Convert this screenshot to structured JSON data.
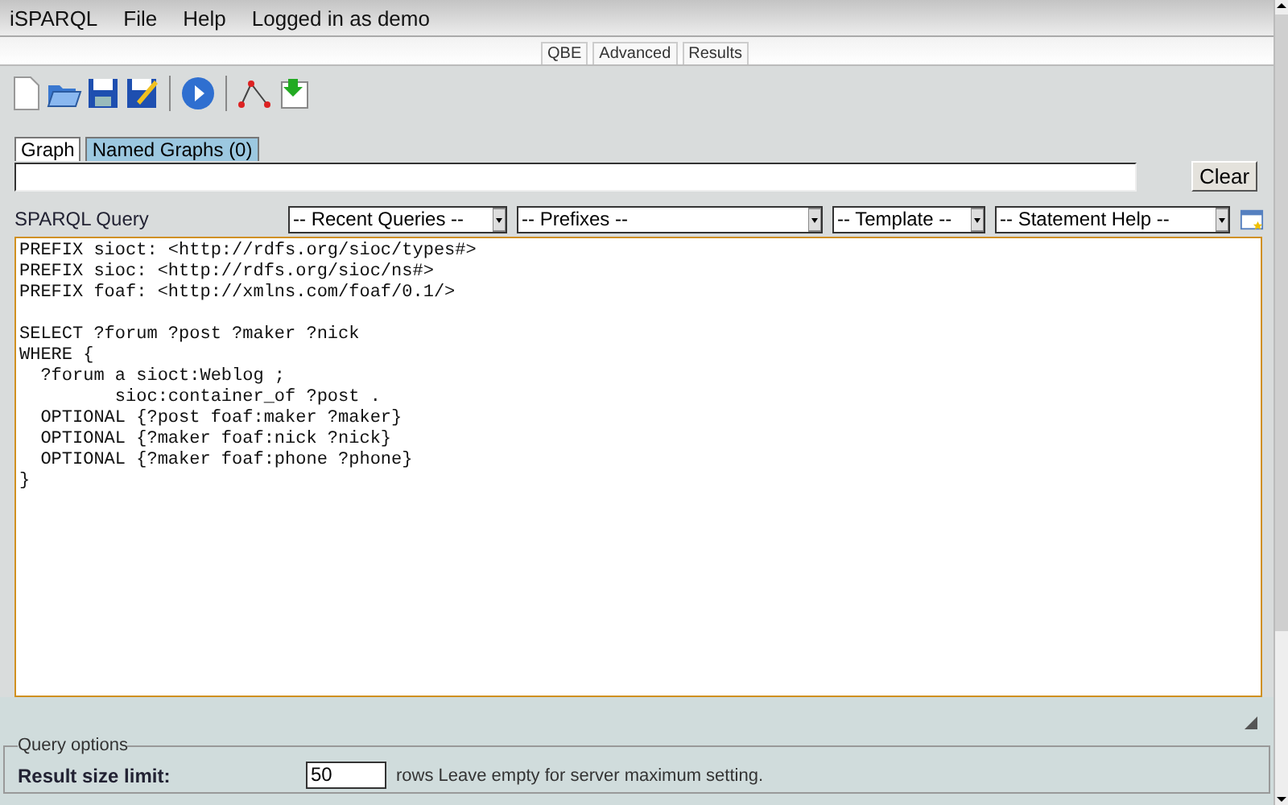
{
  "menu": [
    "iSPARQL",
    "File",
    "Help",
    "Logged in as demo"
  ],
  "view_tabs": [
    {
      "label": "QBE"
    },
    {
      "label": "Advanced"
    },
    {
      "label": "Results"
    }
  ],
  "graph_tabs": [
    {
      "label": "Graph",
      "selected": true
    },
    {
      "label": "Named Graphs (0)",
      "selected": false
    }
  ],
  "graph_input": {
    "button": "Clear"
  },
  "query": {
    "label": "SPARQL Query",
    "dropdowns": [
      "-- Recent Queries --",
      "-- Prefixes --",
      "-- Template --",
      "-- Statement Help --"
    ],
    "text": "PREFIX sioct: <http://rdfs.org/sioc/types#>\nPREFIX sioc: <http://rdfs.org/sioc/ns#>\nPREFIX foaf: <http://xmlns.com/foaf/0.1/>\n\nSELECT ?forum ?post ?maker ?nick\nWHERE {\n  ?forum a sioct:Weblog ;\n         sioc:container_of ?post .\n  OPTIONAL {?post foaf:maker ?maker}\n  OPTIONAL {?maker foaf:nick ?nick}\n  OPTIONAL {?maker foaf:phone ?phone}\n}"
  },
  "options": {
    "legend": "Query options",
    "label": "Result size limit:",
    "value": "50",
    "hint": "rows Leave empty for server maximum setting."
  }
}
